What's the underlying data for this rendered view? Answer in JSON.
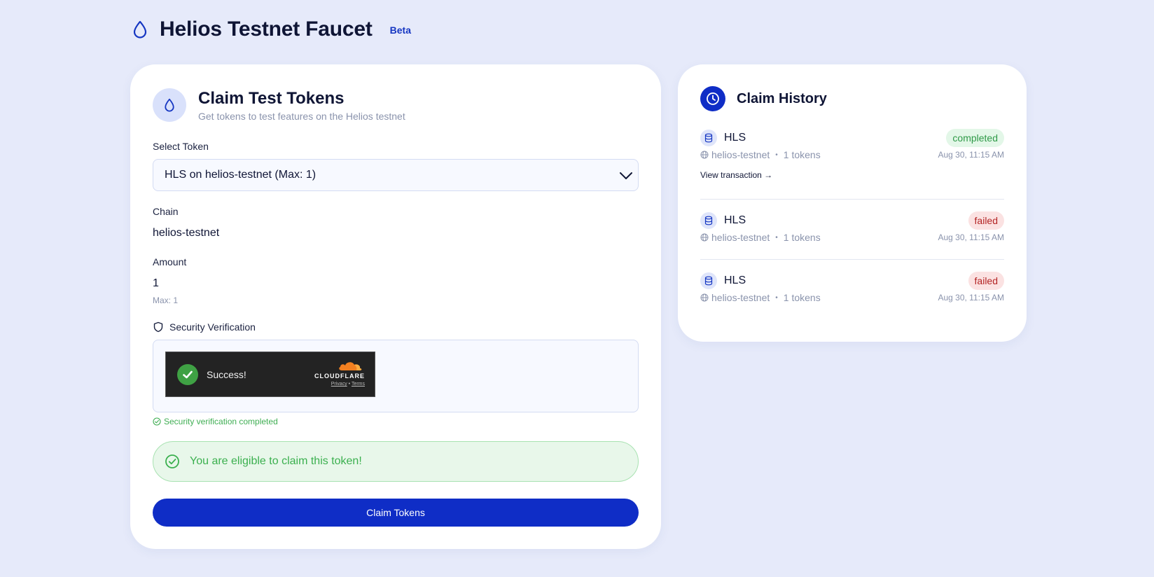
{
  "header": {
    "title": "Helios Testnet Faucet",
    "badge": "Beta",
    "icon": "droplet-icon"
  },
  "claim": {
    "title": "Claim Test Tokens",
    "subtitle": "Get tokens to test features on the Helios testnet",
    "select_label": "Select Token",
    "select_value": "HLS on helios-testnet (Max: 1)",
    "chain_label": "Chain",
    "chain_value": "helios-testnet",
    "amount_label": "Amount",
    "amount_value": "1",
    "amount_max": "Max: 1",
    "security_label": "Security Verification",
    "widget": {
      "status": "Success!",
      "brand": "CLOUDFLARE",
      "privacy": "Privacy",
      "separator": "•",
      "terms": "Terms"
    },
    "verification_status": "Security verification completed",
    "eligible_message": "You are eligible to claim this token!",
    "button_label": "Claim Tokens"
  },
  "history": {
    "title": "Claim History",
    "view_tx_label": "View transaction →",
    "items": [
      {
        "token": "HLS",
        "status": "completed",
        "chain": "helios-testnet",
        "amount": "1 tokens",
        "time": "Aug 30, 11:15 AM"
      },
      {
        "token": "HLS",
        "status": "failed",
        "chain": "helios-testnet",
        "amount": "1 tokens",
        "time": "Aug 30, 11:15 AM"
      },
      {
        "token": "HLS",
        "status": "failed",
        "chain": "helios-testnet",
        "amount": "1 tokens",
        "time": "Aug 30, 11:15 AM"
      }
    ]
  },
  "colors": {
    "background": "#e6eafa",
    "primary": "#0f2dc6",
    "success": "#3bb04f",
    "failed": "#b32424"
  }
}
